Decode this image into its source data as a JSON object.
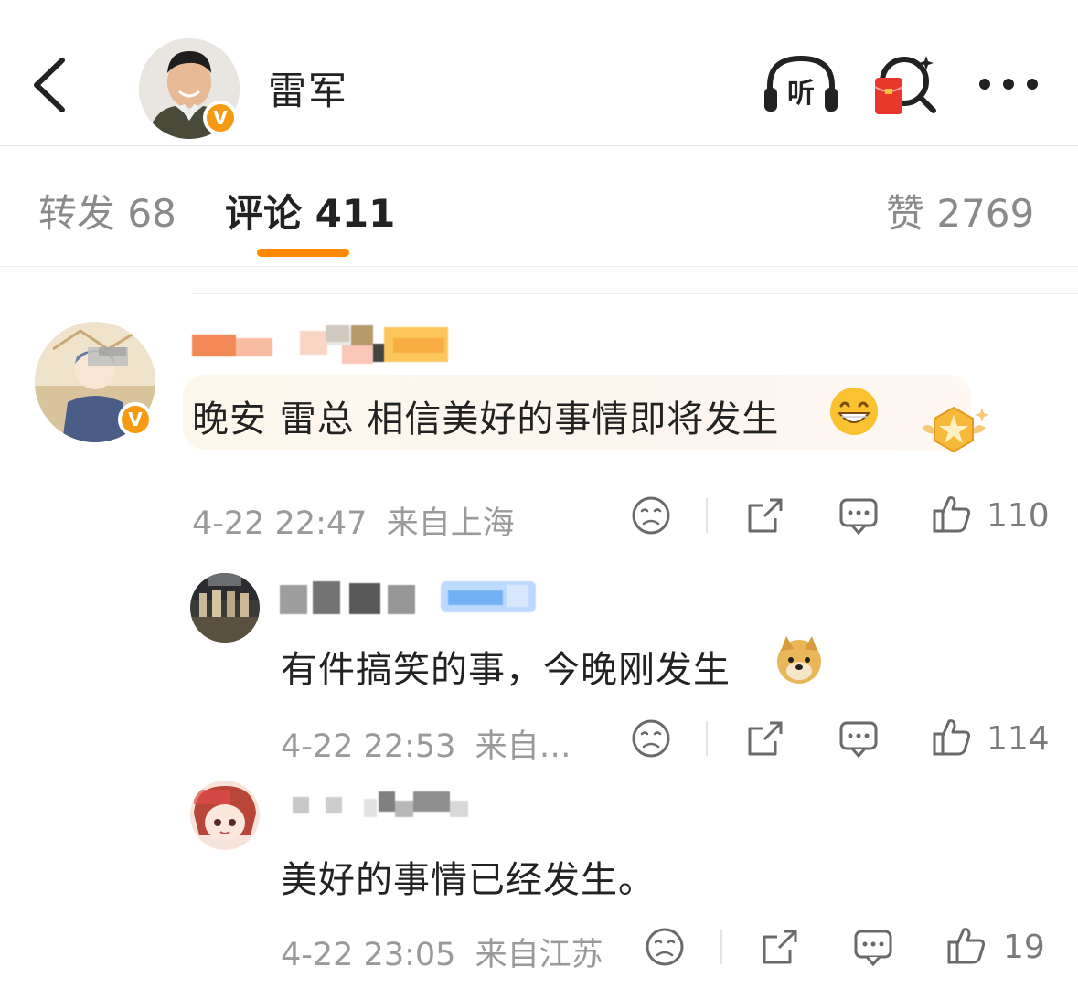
{
  "header": {
    "title": "雷军",
    "listen_label": "听",
    "verified_mark": "V"
  },
  "tabs": [
    {
      "label": "转发 68",
      "active": false
    },
    {
      "label": "评论 411",
      "active": true
    },
    {
      "label": "赞 2769",
      "active": false
    }
  ],
  "accent_color": "#ff8a00",
  "comments": [
    {
      "text": "晚安 雷总 相信美好的事情即将发生",
      "time": "4-22 22:47",
      "location": "来自上海",
      "likes": "110",
      "emoji": "grin-emoji",
      "verified_mark": "V"
    },
    {
      "text": "有件搞笑的事，今晚刚发生",
      "time": "4-22 22:53",
      "location": "来自…",
      "likes": "114",
      "emoji": "doge-emoji"
    },
    {
      "text": "美好的事情已经发生。",
      "time": "4-22 23:05",
      "location": "来自江苏",
      "likes": "19"
    }
  ]
}
